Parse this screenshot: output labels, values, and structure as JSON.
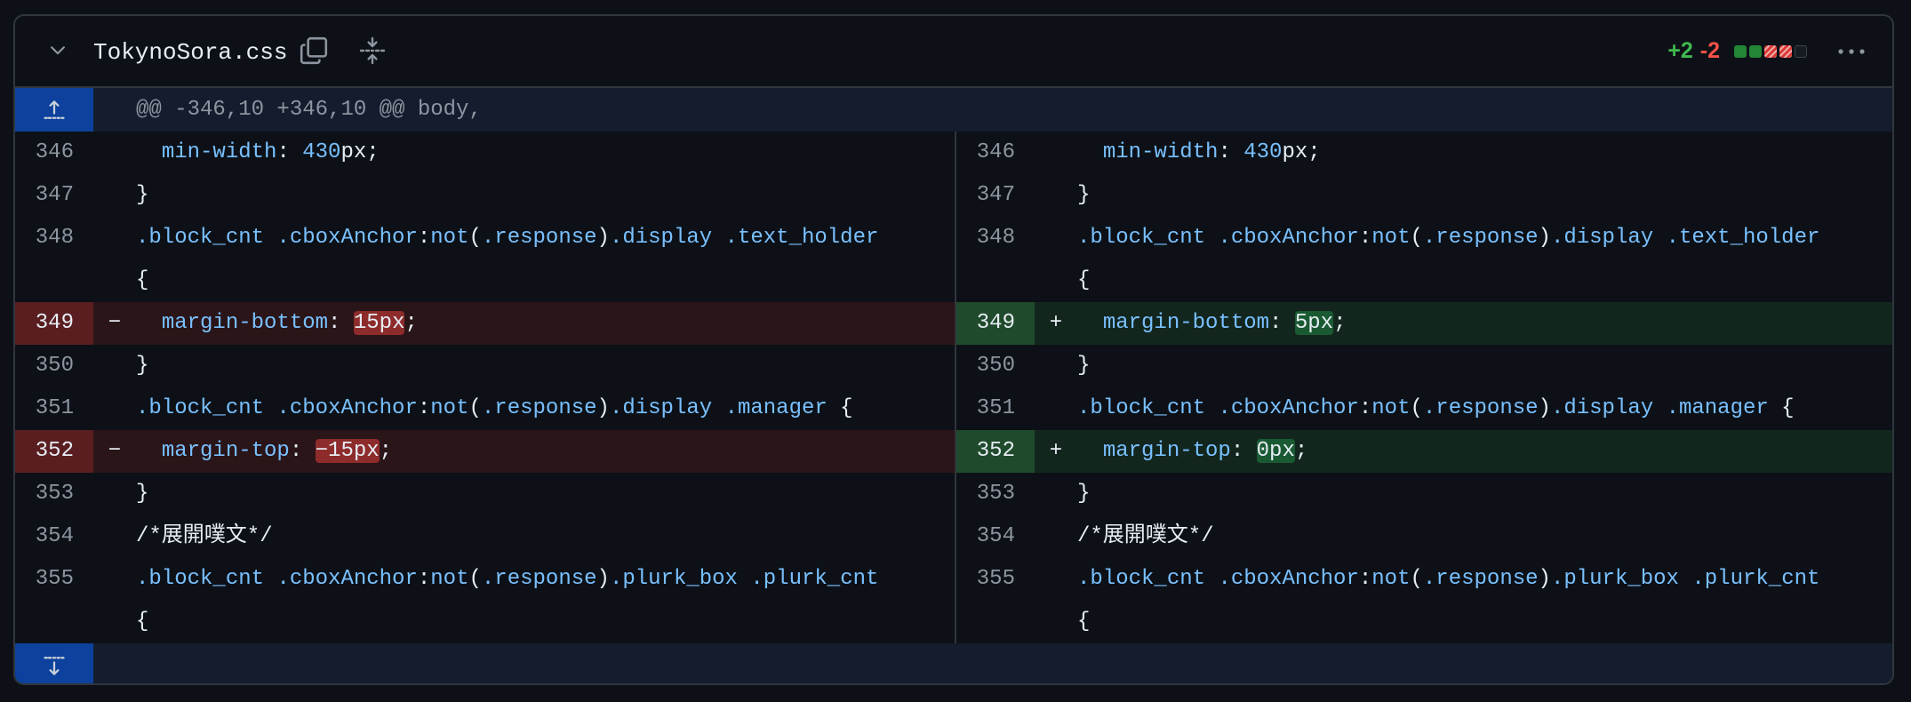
{
  "file": {
    "name": "TokynoSora.css",
    "additions": "+2",
    "deletions": "-2",
    "diffstat": [
      "add",
      "add",
      "del",
      "del",
      "neutral"
    ]
  },
  "hunk": {
    "header": "@@ -346,10 +346,10 @@ body,"
  },
  "icons": {
    "collapse": "chevron-down-icon",
    "copy": "copy-icon",
    "expand": "unfold-icon",
    "more": "kebab-horizontal-icon",
    "expand_up": "expand-up-icon",
    "expand_down": "expand-down-icon"
  },
  "colors": {
    "addition": "#3fb950",
    "deletion": "#f85149",
    "hunk_gutter": "#0d419d"
  },
  "left": [
    {
      "num": "346",
      "type": "ctx",
      "parts": [
        [
          "  ",
          ""
        ],
        [
          "min-width",
          "prop"
        ],
        [
          ": ",
          ""
        ],
        [
          "430",
          "num"
        ],
        [
          "px;",
          ""
        ]
      ]
    },
    {
      "num": "347",
      "type": "ctx",
      "parts": [
        [
          "}",
          ""
        ]
      ]
    },
    {
      "num": "348",
      "type": "ctx",
      "parts": [
        [
          ".block_cnt",
          "sel"
        ],
        [
          " ",
          ""
        ],
        [
          ".cboxAnchor",
          "sel"
        ],
        [
          ":",
          ""
        ],
        [
          "not",
          "fn"
        ],
        [
          "(",
          ""
        ],
        [
          ".response",
          "sel"
        ],
        [
          ")",
          ""
        ],
        [
          ".display",
          "sel"
        ],
        [
          " ",
          ""
        ],
        [
          ".text_holder",
          "sel"
        ]
      ]
    },
    {
      "num": "",
      "type": "ctx",
      "parts": [
        [
          "{",
          ""
        ]
      ]
    },
    {
      "num": "349",
      "type": "del",
      "mark": "−",
      "parts": [
        [
          "  ",
          ""
        ],
        [
          "margin-bottom",
          "prop"
        ],
        [
          ": ",
          ""
        ],
        [
          "15px",
          "hl"
        ],
        [
          ";",
          ""
        ]
      ]
    },
    {
      "num": "350",
      "type": "ctx",
      "parts": [
        [
          "}",
          ""
        ]
      ]
    },
    {
      "num": "351",
      "type": "ctx",
      "parts": [
        [
          ".block_cnt",
          "sel"
        ],
        [
          " ",
          ""
        ],
        [
          ".cboxAnchor",
          "sel"
        ],
        [
          ":",
          ""
        ],
        [
          "not",
          "fn"
        ],
        [
          "(",
          ""
        ],
        [
          ".response",
          "sel"
        ],
        [
          ")",
          ""
        ],
        [
          ".display",
          "sel"
        ],
        [
          " ",
          ""
        ],
        [
          ".manager",
          "sel"
        ],
        [
          " {",
          ""
        ]
      ]
    },
    {
      "num": "352",
      "type": "del",
      "mark": "−",
      "parts": [
        [
          "  ",
          ""
        ],
        [
          "margin-top",
          "prop"
        ],
        [
          ": ",
          ""
        ],
        [
          "−15px",
          "hl"
        ],
        [
          ";",
          ""
        ]
      ]
    },
    {
      "num": "353",
      "type": "ctx",
      "parts": [
        [
          "}",
          ""
        ]
      ]
    },
    {
      "num": "354",
      "type": "ctx",
      "parts": [
        [
          "/*展開噗文*/",
          ""
        ]
      ]
    },
    {
      "num": "355",
      "type": "ctx",
      "parts": [
        [
          ".block_cnt",
          "sel"
        ],
        [
          " ",
          ""
        ],
        [
          ".cboxAnchor",
          "sel"
        ],
        [
          ":",
          ""
        ],
        [
          "not",
          "fn"
        ],
        [
          "(",
          ""
        ],
        [
          ".response",
          "sel"
        ],
        [
          ")",
          ""
        ],
        [
          ".plurk_box",
          "sel"
        ],
        [
          " ",
          ""
        ],
        [
          ".plurk_cnt",
          "sel"
        ]
      ]
    },
    {
      "num": "",
      "type": "ctx",
      "parts": [
        [
          "{",
          ""
        ]
      ]
    }
  ],
  "right": [
    {
      "num": "346",
      "type": "ctx",
      "parts": [
        [
          "  ",
          ""
        ],
        [
          "min-width",
          "prop"
        ],
        [
          ": ",
          ""
        ],
        [
          "430",
          "num"
        ],
        [
          "px;",
          ""
        ]
      ]
    },
    {
      "num": "347",
      "type": "ctx",
      "parts": [
        [
          "}",
          ""
        ]
      ]
    },
    {
      "num": "348",
      "type": "ctx",
      "parts": [
        [
          ".block_cnt",
          "sel"
        ],
        [
          " ",
          ""
        ],
        [
          ".cboxAnchor",
          "sel"
        ],
        [
          ":",
          ""
        ],
        [
          "not",
          "fn"
        ],
        [
          "(",
          ""
        ],
        [
          ".response",
          "sel"
        ],
        [
          ")",
          ""
        ],
        [
          ".display",
          "sel"
        ],
        [
          " ",
          ""
        ],
        [
          ".text_holder",
          "sel"
        ]
      ]
    },
    {
      "num": "",
      "type": "ctx",
      "parts": [
        [
          "{",
          ""
        ]
      ]
    },
    {
      "num": "349",
      "type": "add",
      "mark": "+",
      "parts": [
        [
          "  ",
          ""
        ],
        [
          "margin-bottom",
          "prop"
        ],
        [
          ": ",
          ""
        ],
        [
          "5px",
          "hl"
        ],
        [
          ";",
          ""
        ]
      ]
    },
    {
      "num": "350",
      "type": "ctx",
      "parts": [
        [
          "}",
          ""
        ]
      ]
    },
    {
      "num": "351",
      "type": "ctx",
      "parts": [
        [
          ".block_cnt",
          "sel"
        ],
        [
          " ",
          ""
        ],
        [
          ".cboxAnchor",
          "sel"
        ],
        [
          ":",
          ""
        ],
        [
          "not",
          "fn"
        ],
        [
          "(",
          ""
        ],
        [
          ".response",
          "sel"
        ],
        [
          ")",
          ""
        ],
        [
          ".display",
          "sel"
        ],
        [
          " ",
          ""
        ],
        [
          ".manager",
          "sel"
        ],
        [
          " {",
          ""
        ]
      ]
    },
    {
      "num": "352",
      "type": "add",
      "mark": "+",
      "parts": [
        [
          "  ",
          ""
        ],
        [
          "margin-top",
          "prop"
        ],
        [
          ": ",
          ""
        ],
        [
          "0px",
          "hl"
        ],
        [
          ";",
          ""
        ]
      ]
    },
    {
      "num": "353",
      "type": "ctx",
      "parts": [
        [
          "}",
          ""
        ]
      ]
    },
    {
      "num": "354",
      "type": "ctx",
      "parts": [
        [
          "/*展開噗文*/",
          ""
        ]
      ]
    },
    {
      "num": "355",
      "type": "ctx",
      "parts": [
        [
          ".block_cnt",
          "sel"
        ],
        [
          " ",
          ""
        ],
        [
          ".cboxAnchor",
          "sel"
        ],
        [
          ":",
          ""
        ],
        [
          "not",
          "fn"
        ],
        [
          "(",
          ""
        ],
        [
          ".response",
          "sel"
        ],
        [
          ")",
          ""
        ],
        [
          ".plurk_box",
          "sel"
        ],
        [
          " ",
          ""
        ],
        [
          ".plurk_cnt",
          "sel"
        ]
      ]
    },
    {
      "num": "",
      "type": "ctx",
      "parts": [
        [
          "{",
          ""
        ]
      ]
    }
  ]
}
